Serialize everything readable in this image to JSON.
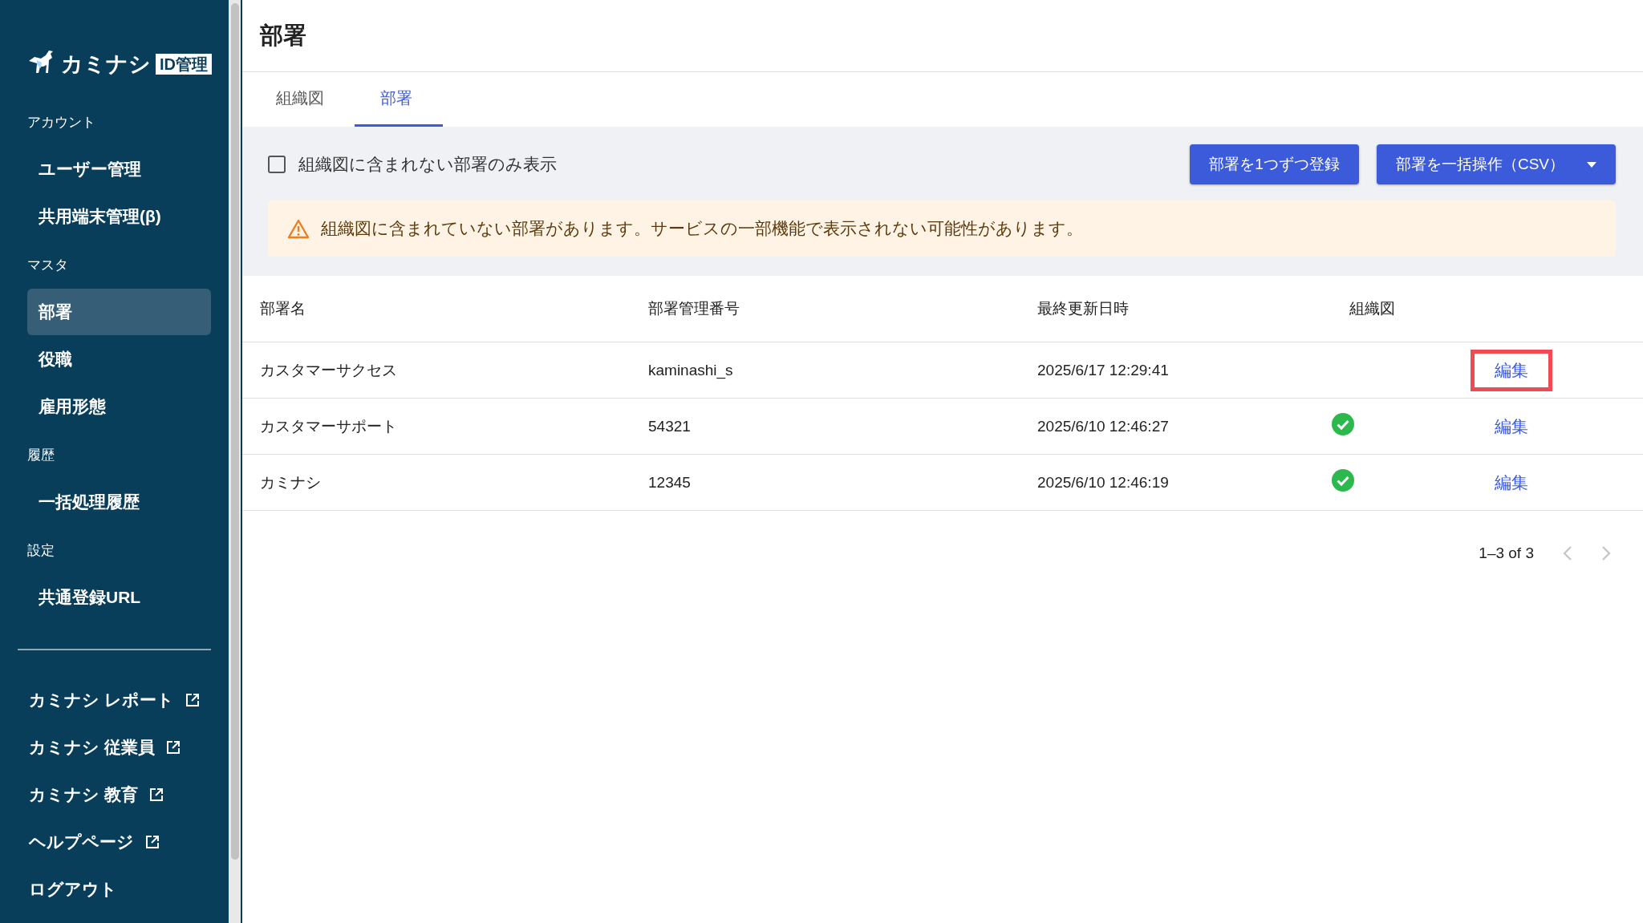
{
  "sidebar": {
    "logo": {
      "name": "カミナシ",
      "badge": "ID管理"
    },
    "sections": [
      {
        "label": "アカウント",
        "items": [
          {
            "label": "ユーザー管理",
            "selected": false
          },
          {
            "label": "共用端末管理(β)",
            "selected": false
          }
        ]
      },
      {
        "label": "マスタ",
        "items": [
          {
            "label": "部署",
            "selected": true
          },
          {
            "label": "役職",
            "selected": false
          },
          {
            "label": "雇用形態",
            "selected": false
          }
        ]
      },
      {
        "label": "履歴",
        "items": [
          {
            "label": "一括処理履歴",
            "selected": false
          }
        ]
      },
      {
        "label": "設定",
        "items": [
          {
            "label": "共通登録URL",
            "selected": false
          }
        ]
      }
    ],
    "links": [
      {
        "label": "カミナシ レポート",
        "external": true
      },
      {
        "label": "カミナシ 従業員",
        "external": true
      },
      {
        "label": "カミナシ 教育",
        "external": true
      },
      {
        "label": "ヘルプページ",
        "external": true
      },
      {
        "label": "ログアウト",
        "external": false
      }
    ]
  },
  "page": {
    "title": "部署"
  },
  "tabs": [
    {
      "label": "組織図",
      "selected": false
    },
    {
      "label": "部署",
      "selected": true
    }
  ],
  "filter": {
    "label": "組織図に含まれない部署のみ表示",
    "checked": false
  },
  "buttons": [
    {
      "label": "部署を1つずつ登録",
      "dropdown": false
    },
    {
      "label": "部署を一括操作（CSV）",
      "dropdown": true
    }
  ],
  "alert": {
    "kind": "warning",
    "text": "組織図に含まれていない部署があります。サービスの一部機能で表示されない可能性があります。"
  },
  "table": {
    "columns": [
      "部署名",
      "部署管理番号",
      "最終更新日時",
      "組織図"
    ],
    "rows": [
      {
        "cells": [
          "カスタマーサクセス",
          "kaminashi_s",
          "2025/6/17 12:29:41"
        ],
        "in_chart": false,
        "action": "編集",
        "highlighted": true
      },
      {
        "cells": [
          "カスタマーサポート",
          "54321",
          "2025/6/10 12:46:27"
        ],
        "in_chart": true,
        "action": "編集",
        "highlighted": false
      },
      {
        "cells": [
          "カミナシ",
          "12345",
          "2025/6/10 12:46:19"
        ],
        "in_chart": true,
        "action": "編集",
        "highlighted": false
      }
    ]
  },
  "pagination": {
    "range": "1–3 of 3",
    "prev_disabled": true,
    "next_disabled": true
  }
}
